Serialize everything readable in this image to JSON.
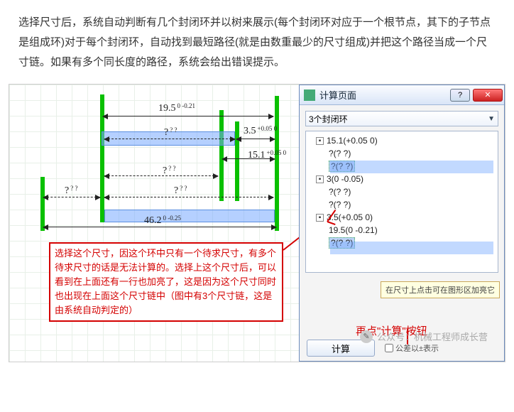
{
  "intro": "选择尺寸后，系统自动判断有几个封闭环并以树来展示(每个封闭环对应于一个根节点，其下的子节点是组成环)对于每个封闭环，自动找到最短路径(就是由数重最少的尺寸组成)并把这个路径当成一个尺寸链。如果有多个同长度的路径，系统会给出错误提示。",
  "panel": {
    "title": "计算页面",
    "dropdown": "3个封闭环",
    "tree": {
      "n1": "15.1(+0.05 0)",
      "n1a": "?(? ?)",
      "n1b": "?(? ?)",
      "n2": "3(0 -0.05)",
      "n2a": "?(? ?)",
      "n2b": "?(? ?)",
      "n3": "3.5(+0.05 0)",
      "n3a": "19.5(0 -0.21)",
      "n3b": "?(? ?)"
    },
    "hint": "在尺寸上点击可在图形区加亮它",
    "compute": "计算",
    "checkbox": "公差以±表示"
  },
  "dims": {
    "d195": "19.5",
    "d195t": "0\n-0.21",
    "dq1": "?",
    "dq1t": "?\n?",
    "d35": "3.5",
    "d35t": "+0.05\n0",
    "d151": "15.1",
    "d151t": "+0.05\n0",
    "dq2": "?",
    "dq2t": "?\n?",
    "dq3": "?",
    "dq3t": "?\n?",
    "dq4": "?",
    "dq4t": "?\n?",
    "d462": "46.2",
    "d462t": "0\n-0.25"
  },
  "callout": "选择这个尺寸，因这个环中只有一个待求尺寸，有多个待求尺寸的话是无法计算的。选择上这个尺寸后，可以看到在上面还有一行也加亮了，这是因为这个尺寸同时也出现在上面这个尺寸链中（图中有3个尺寸链，这是由系统自动判定的）",
  "redtxt": "再点\"计算\"按钮",
  "watermark": "公众号：机械工程师成长营"
}
